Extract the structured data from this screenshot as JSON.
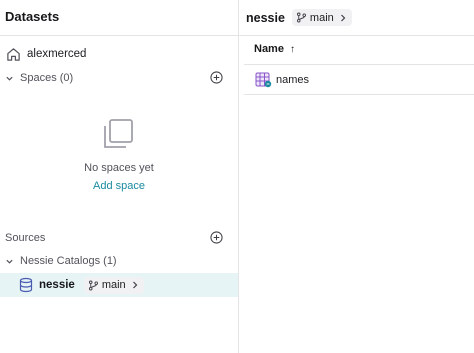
{
  "left_panel": {
    "title": "Datasets",
    "home_label": "alexmerced",
    "spaces": {
      "label": "Spaces (0)",
      "empty_text": "No spaces yet",
      "add_link": "Add space"
    },
    "sources": {
      "label": "Sources",
      "catalogs_label": "Nessie Catalogs (1)",
      "selected_source": {
        "name": "nessie",
        "branch": "main"
      }
    }
  },
  "right_panel": {
    "title": "nessie",
    "branch": "main",
    "table": {
      "column_header": "Name",
      "sort_indicator": "↑",
      "rows": [
        {
          "name": "names"
        }
      ]
    }
  },
  "colors": {
    "accent": "#1a8a9e",
    "selected_row_bg": "#e6f4f6",
    "divider": "#e4e4e7"
  }
}
